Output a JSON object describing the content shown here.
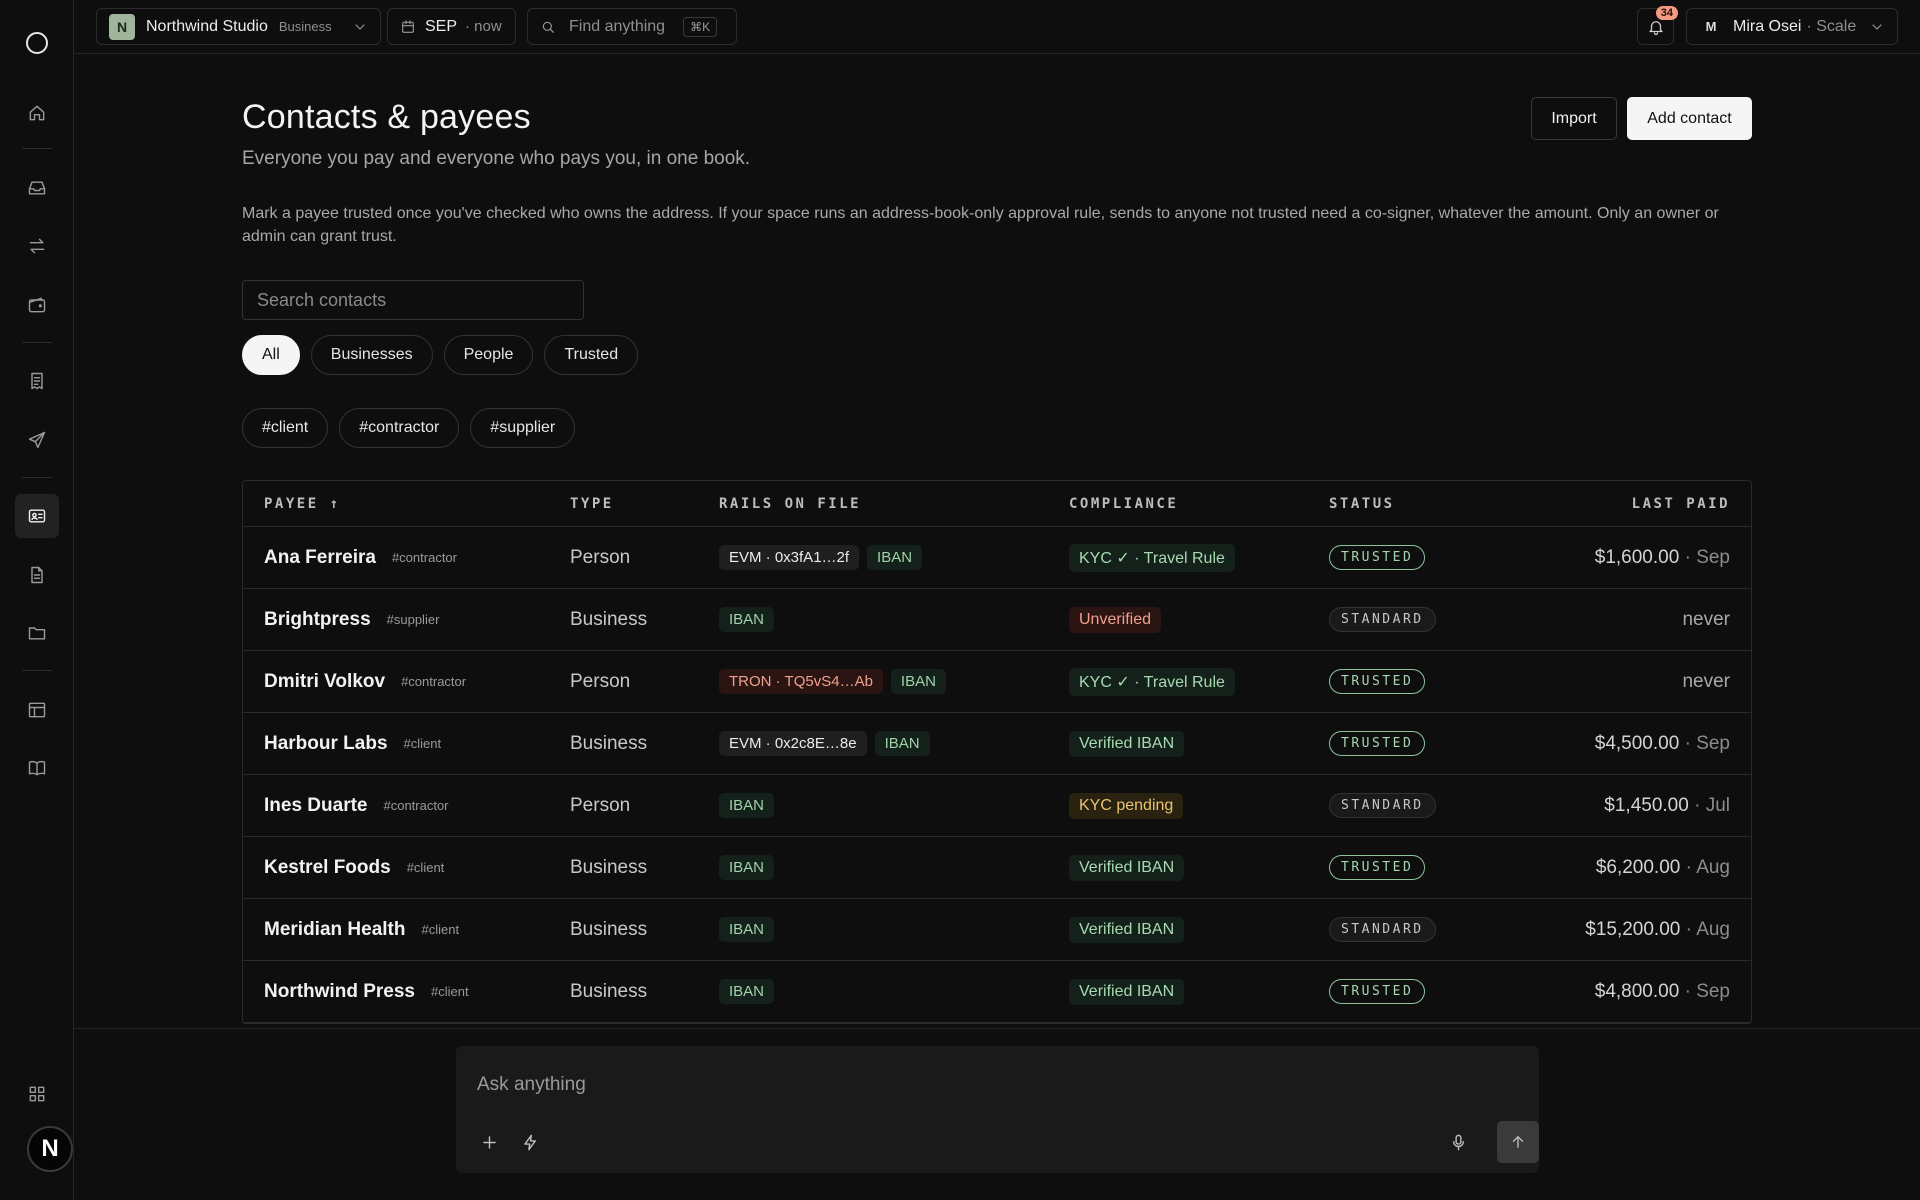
{
  "topbar": {
    "workspace_badge": "N",
    "workspace_name": "Northwind Studio",
    "workspace_plan": "Business",
    "period_label": "SEP",
    "period_suffix": "· now",
    "search_placeholder": "Find anything",
    "search_shortcut": "⌘K",
    "notification_count": "34",
    "user_initial": "M",
    "user_name": "Mira Osei",
    "user_plan": "· Scale"
  },
  "page": {
    "title": "Contacts & payees",
    "subtitle": "Everyone you pay and everyone who pays you, in one book.",
    "import_label": "Import",
    "add_label": "Add contact",
    "note": "Mark a payee trusted once you've checked who owns the address. If your space runs an address-book-only approval rule, sends to anyone not trusted need a co-signer, whatever the amount. Only an owner or admin can grant trust.",
    "search_placeholder": "Search contacts"
  },
  "filters": [
    "All",
    "Businesses",
    "People",
    "Trusted"
  ],
  "tags": [
    "#client",
    "#contractor",
    "#supplier"
  ],
  "table": {
    "columns": {
      "payee": "PAYEE ↑",
      "type": "TYPE",
      "rails": "RAILS ON FILE",
      "compliance": "COMPLIANCE",
      "status": "STATUS",
      "last_paid": "LAST PAID"
    },
    "rows": [
      {
        "name": "Ana Ferreira",
        "tag": "#contractor",
        "type": "Person",
        "rails": [
          {
            "label": "EVM · 0x3fA1…2f",
            "kind": "evm"
          },
          {
            "label": "IBAN",
            "kind": "iban"
          }
        ],
        "compliance": "KYC ✓ · Travel Rule",
        "compliance_kind": "ok",
        "status": "TRUSTED",
        "amount": "$1,600.00",
        "month": "Sep"
      },
      {
        "name": "Brightpress",
        "tag": "#supplier",
        "type": "Business",
        "rails": [
          {
            "label": "IBAN",
            "kind": "iban"
          }
        ],
        "compliance": "Unverified",
        "compliance_kind": "bad",
        "status": "STANDARD",
        "amount": "never",
        "month": ""
      },
      {
        "name": "Dmitri Volkov",
        "tag": "#contractor",
        "type": "Person",
        "rails": [
          {
            "label": "TRON · TQ5vS4…Ab",
            "kind": "tron"
          },
          {
            "label": "IBAN",
            "kind": "iban"
          }
        ],
        "compliance": "KYC ✓ · Travel Rule",
        "compliance_kind": "ok",
        "status": "TRUSTED",
        "amount": "never",
        "month": ""
      },
      {
        "name": "Harbour Labs",
        "tag": "#client",
        "type": "Business",
        "rails": [
          {
            "label": "EVM · 0x2c8E…8e",
            "kind": "evm"
          },
          {
            "label": "IBAN",
            "kind": "iban"
          }
        ],
        "compliance": "Verified IBAN",
        "compliance_kind": "ok",
        "status": "TRUSTED",
        "amount": "$4,500.00",
        "month": "Sep"
      },
      {
        "name": "Ines Duarte",
        "tag": "#contractor",
        "type": "Person",
        "rails": [
          {
            "label": "IBAN",
            "kind": "iban"
          }
        ],
        "compliance": "KYC pending",
        "compliance_kind": "pend",
        "status": "STANDARD",
        "amount": "$1,450.00",
        "month": "Jul"
      },
      {
        "name": "Kestrel Foods",
        "tag": "#client",
        "type": "Business",
        "rails": [
          {
            "label": "IBAN",
            "kind": "iban"
          }
        ],
        "compliance": "Verified IBAN",
        "compliance_kind": "ok",
        "status": "TRUSTED",
        "amount": "$6,200.00",
        "month": "Aug"
      },
      {
        "name": "Meridian Health",
        "tag": "#client",
        "type": "Business",
        "rails": [
          {
            "label": "IBAN",
            "kind": "iban"
          }
        ],
        "compliance": "Verified IBAN",
        "compliance_kind": "ok",
        "status": "STANDARD",
        "amount": "$15,200.00",
        "month": "Aug"
      },
      {
        "name": "Northwind Press",
        "tag": "#client",
        "type": "Business",
        "rails": [
          {
            "label": "IBAN",
            "kind": "iban"
          }
        ],
        "compliance": "Verified IBAN",
        "compliance_kind": "ok",
        "status": "TRUSTED",
        "amount": "$4,800.00",
        "month": "Sep"
      }
    ]
  },
  "composer": {
    "placeholder": "Ask anything"
  },
  "rail": {
    "avatar_letter": "N"
  }
}
